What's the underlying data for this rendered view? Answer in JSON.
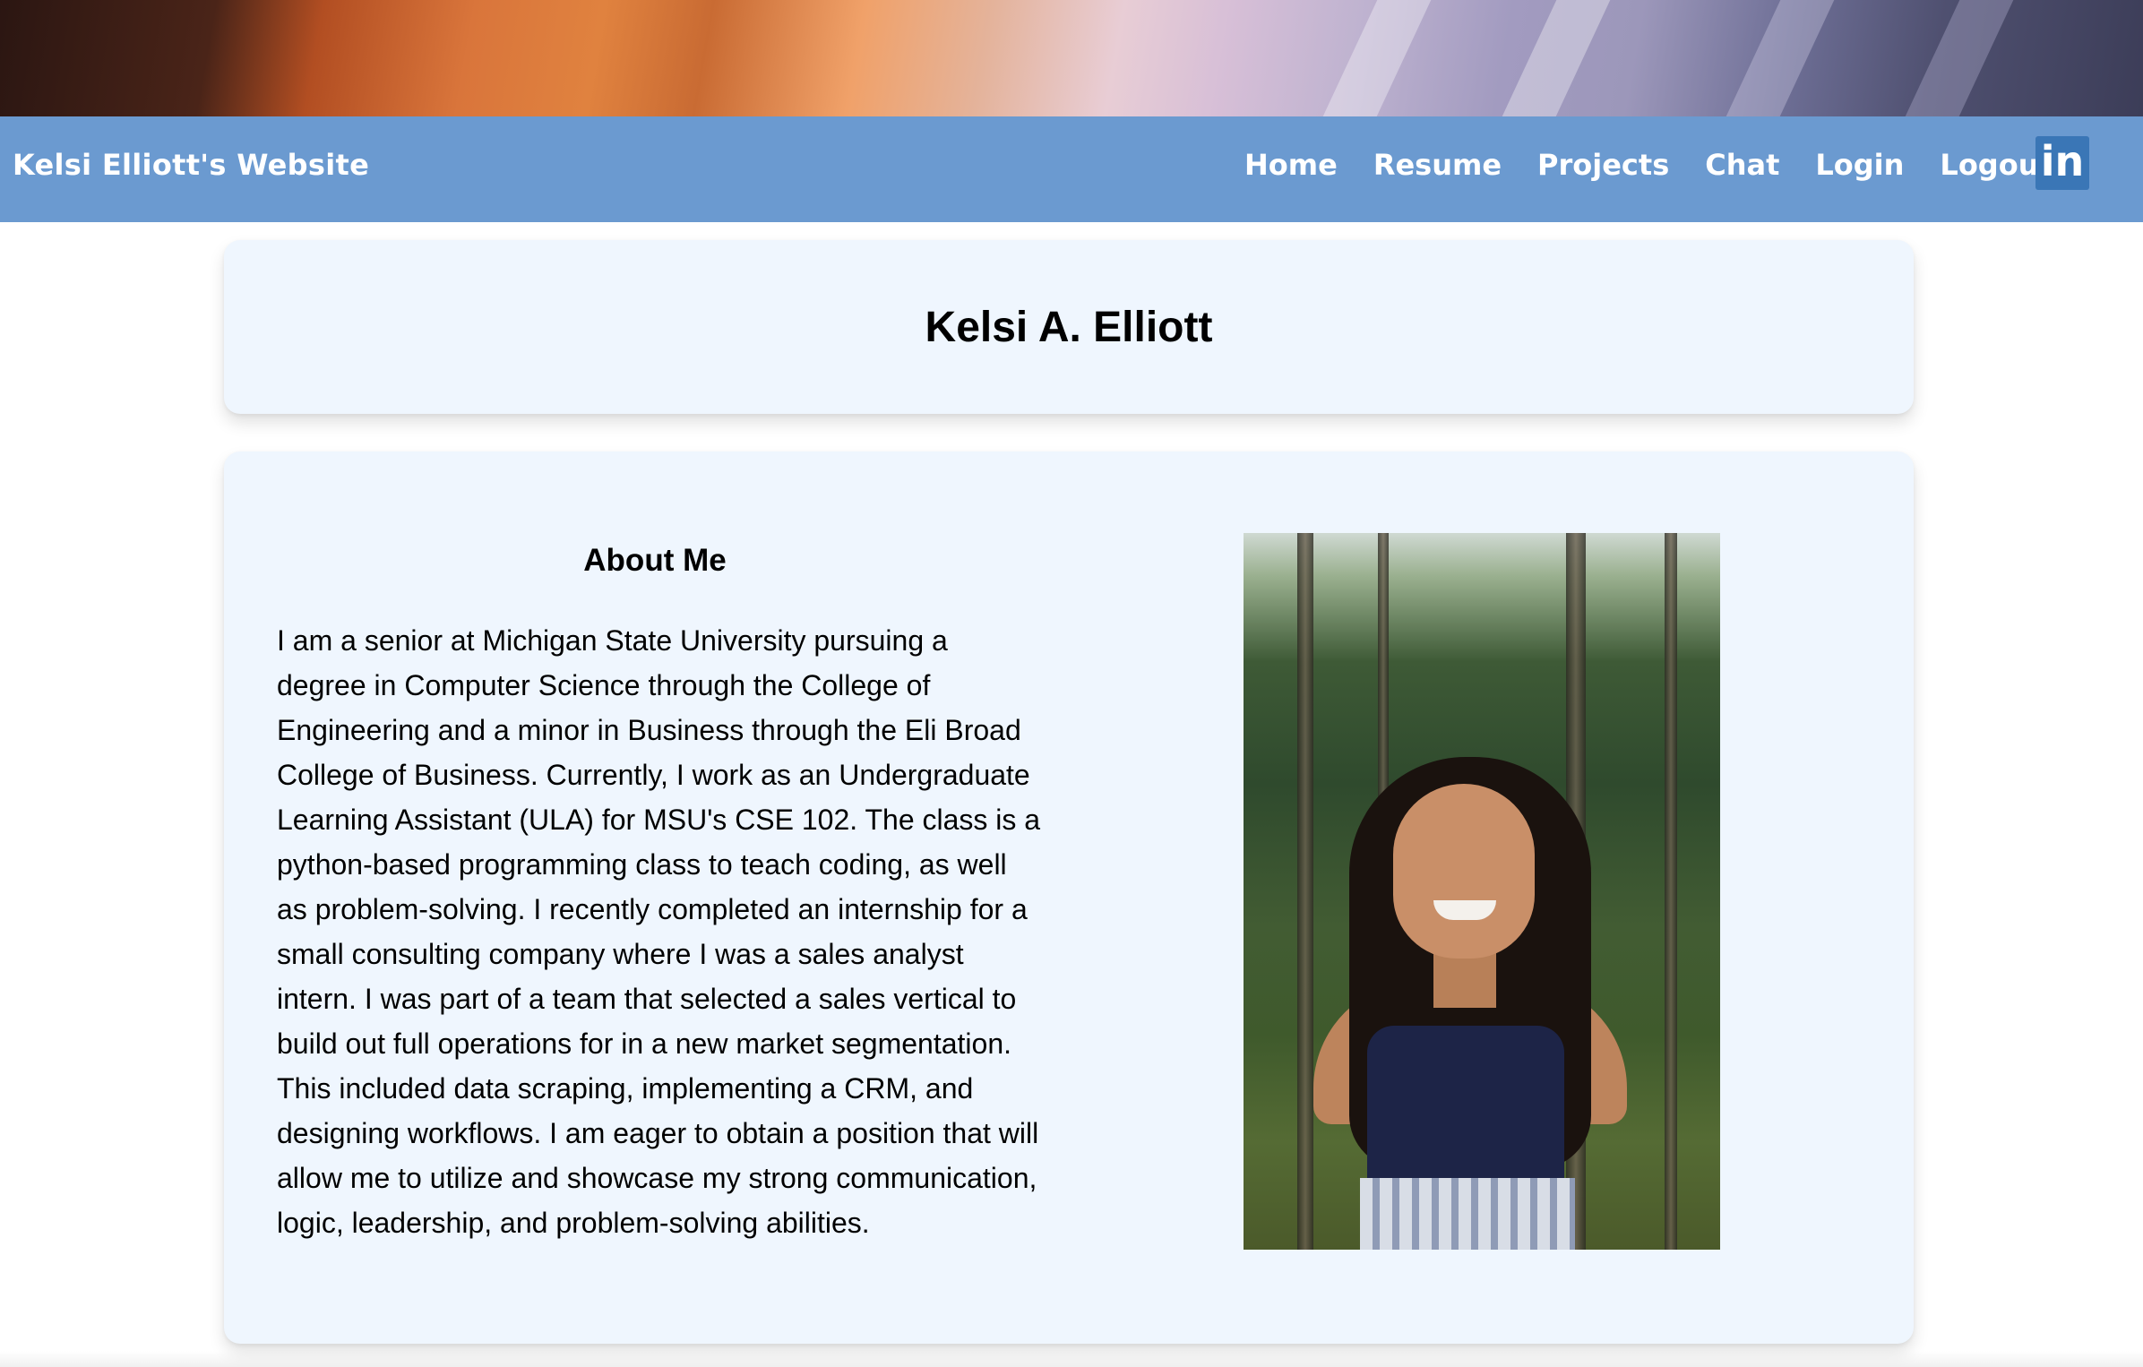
{
  "navbar": {
    "brand": "Kelsi Elliott's Website",
    "links": [
      "Home",
      "Resume",
      "Projects",
      "Chat",
      "Login",
      "Logout"
    ],
    "linkedin_label": "in",
    "color": "#6b9ad0"
  },
  "title_card": {
    "name": "Kelsi A. Elliott"
  },
  "about": {
    "heading": "About Me",
    "paragraph": "I am a senior at Michigan State University pursuing a degree in Computer Science through the College of Engineering and a minor in Business through the Eli Broad College of Business. Currently, I work as an Undergraduate Learning Assistant (ULA) for MSU's CSE 102. The class is a python-based programming class to teach coding, as well as problem-solving. I recently completed an internship for a small consulting company where I was a sales analyst intern. I was part of a team that selected a sales vertical to build out full operations for in a new market segmentation. This included data scraping, implementing a CRM, and designing workflows. I am eager to obtain a position that will allow me to utilize and showcase my strong communication, logic, leadership, and problem-solving abilities."
  },
  "colors": {
    "card_background": "#eff6fe",
    "linkedin_background": "#3a76b6"
  },
  "icons": {
    "linkedin": "linkedin-icon"
  }
}
